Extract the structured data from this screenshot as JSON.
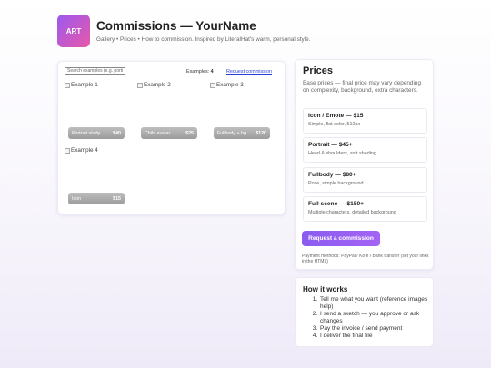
{
  "header": {
    "logo_text": "ART",
    "title": "Commissions — YourName",
    "subtitle": "Gallery • Prices • How to commission. Inspired by LiteralHat's warm, personal style."
  },
  "gallery": {
    "search_placeholder": "Search examples (e.g. portrait)",
    "examples_label": "Examples:",
    "examples_count": "4",
    "request_link": "Request commission",
    "items": [
      {
        "alt": "Example 1",
        "caption": "Portrait study",
        "price": "$40"
      },
      {
        "alt": "Example 2",
        "caption": "Chibi avatar",
        "price": "$25"
      },
      {
        "alt": "Example 3",
        "caption": "Fullbody + bg",
        "price": "$120"
      },
      {
        "alt": "Example 4",
        "caption": "Icon",
        "price": "$15"
      }
    ]
  },
  "prices": {
    "title": "Prices",
    "description": "Base prices — final price may vary depending on complexity, background, extra characters.",
    "tiers": [
      {
        "name": "Icon / Emote — $15",
        "detail": "Simple, flat color, 512px"
      },
      {
        "name": "Portrait — $45+",
        "detail": "Head & shoulders, soft shading"
      },
      {
        "name": "Fullbody — $80+",
        "detail": "Pose, simple background"
      },
      {
        "name": "Full scene — $150+",
        "detail": "Multiple characters, detailed background"
      }
    ],
    "button": "Request a commission",
    "payment_note": "Payment methods: PayPal / Ko-fi / Bank transfer (set your links in the HTML)"
  },
  "how": {
    "title": "How it works",
    "steps": [
      "Tell me what you want (reference images help)",
      "I send a sketch — you approve or ask changes",
      "Pay the invoice / send payment",
      "I deliver the final file"
    ]
  },
  "colors": {
    "accent": "#8a5cf0",
    "link": "#2b3fd6",
    "logo_gradient_start": "#9b59f0",
    "logo_gradient_end": "#e858a8"
  }
}
